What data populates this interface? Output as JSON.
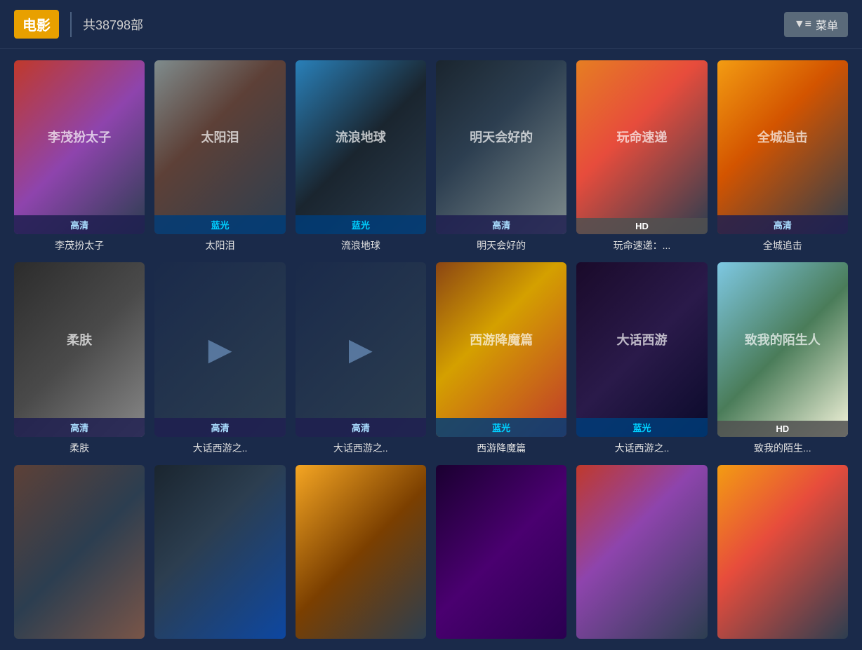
{
  "header": {
    "logo": "电影",
    "count": "共38798部",
    "menu_label": "菜单"
  },
  "movies": [
    {
      "id": 1,
      "title": "李茂扮太子",
      "badge": "高清",
      "badge_type": "high",
      "poster_class": "poster-1",
      "poster_text": "李茂扮太子"
    },
    {
      "id": 2,
      "title": "太阳泪",
      "badge": "蓝光",
      "badge_type": "blue",
      "poster_class": "poster-2",
      "poster_text": "太阳泪"
    },
    {
      "id": 3,
      "title": "流浪地球",
      "badge": "蓝光",
      "badge_type": "blue",
      "poster_class": "poster-3",
      "poster_text": "流浪地球"
    },
    {
      "id": 4,
      "title": "明天会好的",
      "badge": "高清",
      "badge_type": "high",
      "poster_class": "poster-4",
      "poster_text": "明天会好的"
    },
    {
      "id": 5,
      "title": "玩命速递：...",
      "badge": "HD",
      "badge_type": "hd-en",
      "poster_class": "poster-5",
      "poster_text": "玩命速递"
    },
    {
      "id": 6,
      "title": "全城追击",
      "badge": "高清",
      "badge_type": "high",
      "poster_class": "poster-6",
      "poster_text": "全城追击"
    },
    {
      "id": 7,
      "title": "柔肤",
      "badge": "高清",
      "badge_type": "high",
      "poster_class": "poster-7",
      "poster_text": "柔肤",
      "has_image": true
    },
    {
      "id": 8,
      "title": "大话西游之..",
      "badge": "高清",
      "badge_type": "high",
      "poster_class": "poster-8",
      "poster_text": "",
      "has_play": true
    },
    {
      "id": 9,
      "title": "大话西游之..",
      "badge": "高清",
      "badge_type": "high",
      "poster_class": "poster-9",
      "poster_text": "",
      "has_play": true
    },
    {
      "id": 10,
      "title": "西游降魔篇",
      "badge": "蓝光",
      "badge_type": "blue",
      "poster_class": "poster-10",
      "poster_text": "西游降魔篇"
    },
    {
      "id": 11,
      "title": "大话西游之..",
      "badge": "蓝光",
      "badge_type": "blue",
      "poster_class": "poster-11",
      "poster_text": "大话西游"
    },
    {
      "id": 12,
      "title": "致我的陌生...",
      "badge": "HD",
      "badge_type": "hd-en",
      "poster_class": "poster-12",
      "poster_text": "致我的陌生人"
    },
    {
      "id": 13,
      "title": "",
      "badge": "",
      "badge_type": "",
      "poster_class": "poster-13",
      "poster_text": ""
    },
    {
      "id": 14,
      "title": "",
      "badge": "",
      "badge_type": "",
      "poster_class": "poster-14",
      "poster_text": ""
    },
    {
      "id": 15,
      "title": "",
      "badge": "",
      "badge_type": "",
      "poster_class": "poster-15",
      "poster_text": ""
    },
    {
      "id": 16,
      "title": "",
      "badge": "",
      "badge_type": "",
      "poster_class": "poster-16",
      "poster_text": ""
    },
    {
      "id": 17,
      "title": "",
      "badge": "",
      "badge_type": "",
      "poster_class": "poster-17",
      "poster_text": ""
    },
    {
      "id": 18,
      "title": "",
      "badge": "",
      "badge_type": "",
      "poster_class": "poster-18",
      "poster_text": ""
    }
  ],
  "badge_labels": {
    "high": "高清",
    "blue": "蓝光",
    "hd-en": "HD"
  }
}
